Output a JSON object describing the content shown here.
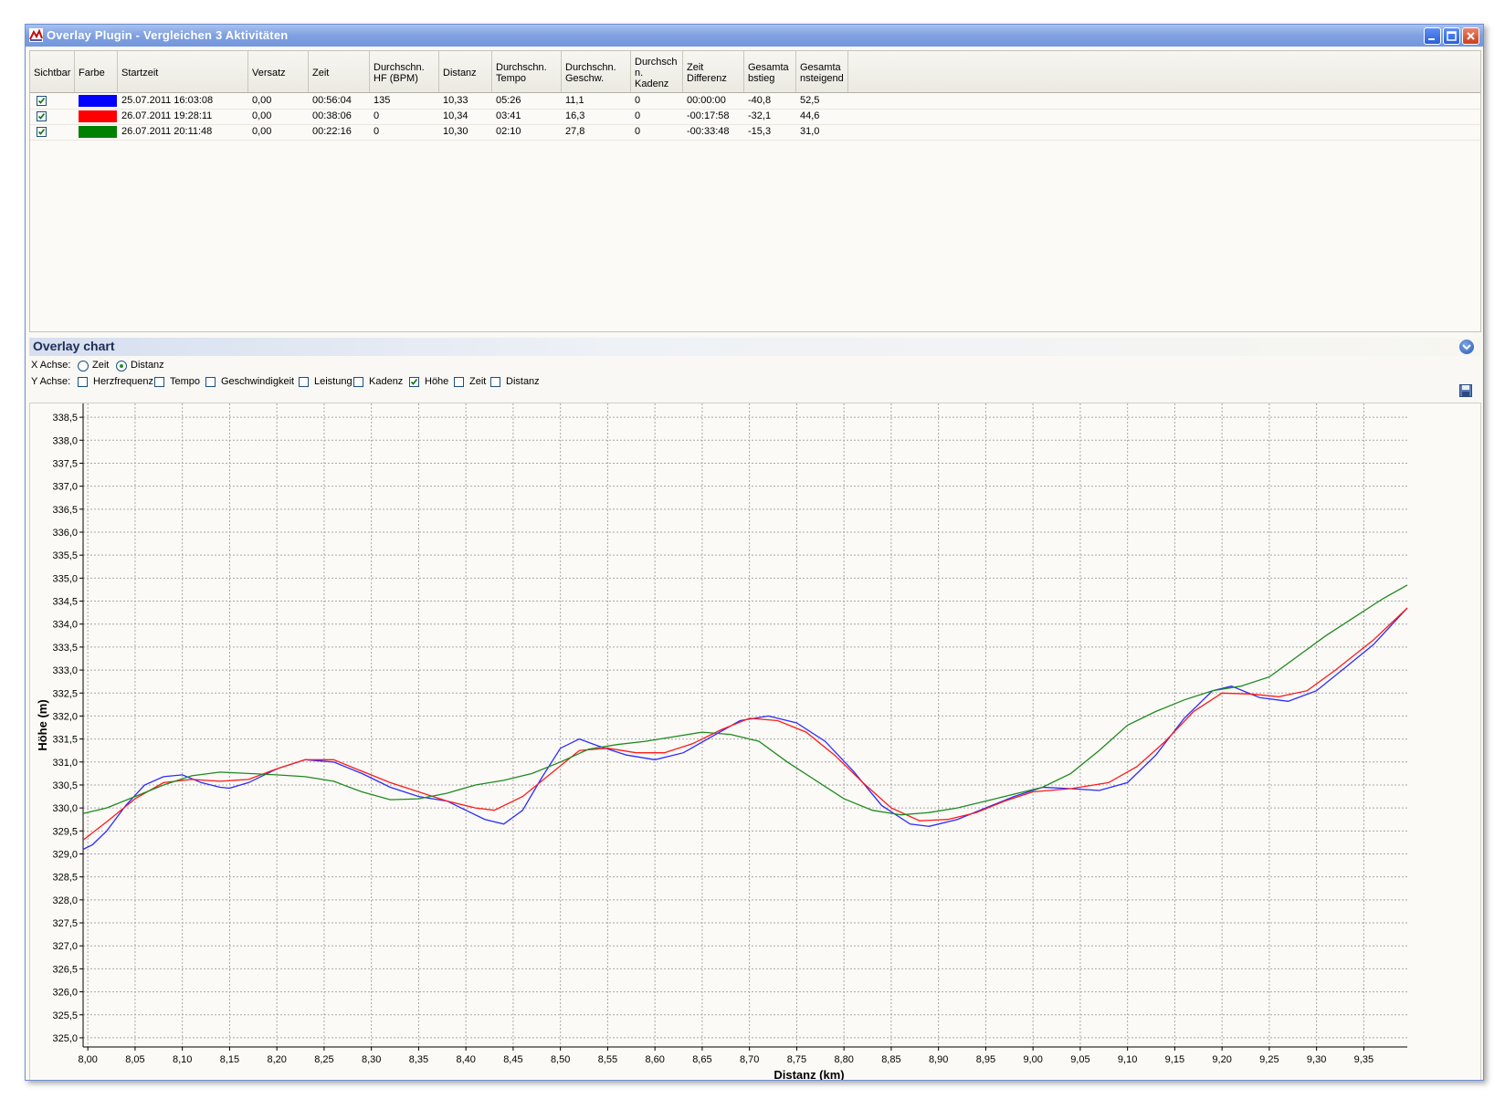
{
  "window": {
    "title": "Overlay Plugin - Vergleichen 3 Aktivitäten",
    "icons": [
      "app-logo-icon",
      "minimize-icon",
      "maximize-icon",
      "close-icon"
    ]
  },
  "table": {
    "headers": [
      "Sichtbar",
      "Farbe",
      "Startzeit",
      "Versatz",
      "Zeit",
      "Durchschn.\nHF (BPM)",
      "Distanz",
      "Durchschn.\nTempo",
      "Durchschn.\nGeschw.",
      "Durchsch\nn.\nKadenz",
      "Zeit\nDifferenz",
      "Gesamta\nbstieg",
      "Gesamta\nnsteigend"
    ],
    "rows": [
      {
        "visible": true,
        "color": "#0000ff",
        "start": "25.07.2011 16:03:08",
        "offset": "0,00",
        "time": "00:56:04",
        "hr": "135",
        "distance": "10,33",
        "pace": "05:26",
        "speed": "11,1",
        "cadence": "0",
        "timediff": "00:00:00",
        "descent": "-40,8",
        "ascent": "52,5"
      },
      {
        "visible": true,
        "color": "#ff0000",
        "start": "26.07.2011 19:28:11",
        "offset": "0,00",
        "time": "00:38:06",
        "hr": "0",
        "distance": "10,34",
        "pace": "03:41",
        "speed": "16,3",
        "cadence": "0",
        "timediff": "-00:17:58",
        "descent": "-32,1",
        "ascent": "44,6"
      },
      {
        "visible": true,
        "color": "#008000",
        "start": "26.07.2011 20:11:48",
        "offset": "0,00",
        "time": "00:22:16",
        "hr": "0",
        "distance": "10,30",
        "pace": "02:10",
        "speed": "27,8",
        "cadence": "0",
        "timediff": "-00:33:48",
        "descent": "-15,3",
        "ascent": "31,0"
      }
    ]
  },
  "chart_panel": {
    "title": "Overlay chart",
    "x_axis_label": "X Achse:",
    "x_options": [
      {
        "label": "Zeit",
        "selected": false
      },
      {
        "label": "Distanz",
        "selected": true
      }
    ],
    "y_axis_label": "Y Achse:",
    "y_options": [
      {
        "label": "Herzfrequenz",
        "checked": false
      },
      {
        "label": "Tempo",
        "checked": false
      },
      {
        "label": "Geschwindigkeit",
        "checked": false
      },
      {
        "label": "Leistung",
        "checked": false
      },
      {
        "label": "Kadenz",
        "checked": false
      },
      {
        "label": "Höhe",
        "checked": true
      },
      {
        "label": "Zeit",
        "checked": false
      },
      {
        "label": "Distanz",
        "checked": false
      }
    ]
  },
  "chart_data": {
    "type": "line",
    "xlabel": "Distanz (km)",
    "ylabel": "Höhe (m)",
    "xlim": [
      7.995,
      9.396
    ],
    "ylim": [
      324.8,
      338.8
    ],
    "x_ticks": [
      "8,00",
      "8,05",
      "8,10",
      "8,15",
      "8,20",
      "8,25",
      "8,30",
      "8,35",
      "8,40",
      "8,45",
      "8,50",
      "8,55",
      "8,60",
      "8,65",
      "8,70",
      "8,75",
      "8,80",
      "8,85",
      "8,90",
      "8,95",
      "9,00",
      "9,05",
      "9,10",
      "9,15",
      "9,20",
      "9,25",
      "9,30",
      "9,35"
    ],
    "y_ticks": [
      "325,0",
      "325,5",
      "326,0",
      "326,5",
      "327,0",
      "327,5",
      "328,0",
      "328,5",
      "329,0",
      "329,5",
      "330,0",
      "330,5",
      "331,0",
      "331,5",
      "332,0",
      "332,5",
      "333,0",
      "333,5",
      "334,0",
      "334,5",
      "335,0",
      "335,5",
      "336,0",
      "336,5",
      "337,0",
      "337,5",
      "338,0",
      "338,5"
    ],
    "grid": true,
    "series": [
      {
        "color": "#2b2bff",
        "points": [
          [
            7.995,
            329.1
          ],
          [
            8.005,
            329.2
          ],
          [
            8.02,
            329.5
          ],
          [
            8.04,
            330.05
          ],
          [
            8.06,
            330.5
          ],
          [
            8.08,
            330.68
          ],
          [
            8.1,
            330.72
          ],
          [
            8.12,
            330.55
          ],
          [
            8.14,
            330.45
          ],
          [
            8.15,
            330.43
          ],
          [
            8.17,
            330.55
          ],
          [
            8.2,
            330.85
          ],
          [
            8.23,
            331.05
          ],
          [
            8.26,
            331.0
          ],
          [
            8.29,
            330.75
          ],
          [
            8.32,
            330.45
          ],
          [
            8.35,
            330.25
          ],
          [
            8.38,
            330.15
          ],
          [
            8.4,
            329.95
          ],
          [
            8.42,
            329.75
          ],
          [
            8.44,
            329.65
          ],
          [
            8.46,
            329.95
          ],
          [
            8.48,
            330.65
          ],
          [
            8.5,
            331.3
          ],
          [
            8.52,
            331.5
          ],
          [
            8.54,
            331.35
          ],
          [
            8.57,
            331.15
          ],
          [
            8.6,
            331.05
          ],
          [
            8.63,
            331.2
          ],
          [
            8.66,
            331.55
          ],
          [
            8.69,
            331.9
          ],
          [
            8.72,
            332.0
          ],
          [
            8.75,
            331.85
          ],
          [
            8.78,
            331.45
          ],
          [
            8.81,
            330.8
          ],
          [
            8.84,
            330.05
          ],
          [
            8.87,
            329.65
          ],
          [
            8.89,
            329.6
          ],
          [
            8.92,
            329.75
          ],
          [
            8.95,
            330.0
          ],
          [
            8.98,
            330.25
          ],
          [
            9.01,
            330.45
          ],
          [
            9.04,
            330.42
          ],
          [
            9.07,
            330.38
          ],
          [
            9.1,
            330.55
          ],
          [
            9.13,
            331.15
          ],
          [
            9.16,
            331.95
          ],
          [
            9.19,
            332.55
          ],
          [
            9.21,
            332.65
          ],
          [
            9.24,
            332.4
          ],
          [
            9.27,
            332.32
          ],
          [
            9.3,
            332.55
          ],
          [
            9.33,
            333.05
          ],
          [
            9.36,
            333.55
          ],
          [
            9.396,
            334.35
          ]
        ]
      },
      {
        "color": "#ff1a1a",
        "points": [
          [
            7.995,
            329.3
          ],
          [
            8.02,
            329.7
          ],
          [
            8.05,
            330.2
          ],
          [
            8.08,
            330.55
          ],
          [
            8.11,
            330.62
          ],
          [
            8.14,
            330.58
          ],
          [
            8.17,
            330.62
          ],
          [
            8.2,
            330.85
          ],
          [
            8.23,
            331.05
          ],
          [
            8.26,
            331.05
          ],
          [
            8.29,
            330.8
          ],
          [
            8.32,
            330.55
          ],
          [
            8.35,
            330.35
          ],
          [
            8.38,
            330.15
          ],
          [
            8.41,
            330.0
          ],
          [
            8.43,
            329.95
          ],
          [
            8.46,
            330.25
          ],
          [
            8.49,
            330.75
          ],
          [
            8.52,
            331.25
          ],
          [
            8.55,
            331.3
          ],
          [
            8.58,
            331.2
          ],
          [
            8.61,
            331.2
          ],
          [
            8.64,
            331.4
          ],
          [
            8.67,
            331.7
          ],
          [
            8.7,
            331.95
          ],
          [
            8.73,
            331.9
          ],
          [
            8.76,
            331.65
          ],
          [
            8.79,
            331.15
          ],
          [
            8.82,
            330.55
          ],
          [
            8.85,
            330.0
          ],
          [
            8.88,
            329.72
          ],
          [
            8.91,
            329.75
          ],
          [
            8.94,
            329.9
          ],
          [
            8.97,
            330.15
          ],
          [
            9.0,
            330.35
          ],
          [
            9.04,
            330.42
          ],
          [
            9.08,
            330.55
          ],
          [
            9.11,
            330.9
          ],
          [
            9.14,
            331.45
          ],
          [
            9.17,
            332.1
          ],
          [
            9.2,
            332.5
          ],
          [
            9.23,
            332.48
          ],
          [
            9.26,
            332.42
          ],
          [
            9.29,
            332.55
          ],
          [
            9.32,
            333.0
          ],
          [
            9.36,
            333.65
          ],
          [
            9.396,
            334.35
          ]
        ]
      },
      {
        "color": "#1f8a1f",
        "points": [
          [
            7.995,
            329.88
          ],
          [
            8.02,
            330.0
          ],
          [
            8.05,
            330.25
          ],
          [
            8.08,
            330.5
          ],
          [
            8.11,
            330.7
          ],
          [
            8.14,
            330.78
          ],
          [
            8.17,
            330.75
          ],
          [
            8.2,
            330.72
          ],
          [
            8.23,
            330.68
          ],
          [
            8.26,
            330.58
          ],
          [
            8.29,
            330.35
          ],
          [
            8.32,
            330.18
          ],
          [
            8.35,
            330.2
          ],
          [
            8.38,
            330.32
          ],
          [
            8.41,
            330.5
          ],
          [
            8.44,
            330.6
          ],
          [
            8.47,
            330.75
          ],
          [
            8.5,
            331.0
          ],
          [
            8.53,
            331.28
          ],
          [
            8.56,
            331.38
          ],
          [
            8.59,
            331.45
          ],
          [
            8.62,
            331.55
          ],
          [
            8.65,
            331.65
          ],
          [
            8.68,
            331.6
          ],
          [
            8.71,
            331.45
          ],
          [
            8.74,
            331.0
          ],
          [
            8.77,
            330.6
          ],
          [
            8.8,
            330.2
          ],
          [
            8.83,
            329.95
          ],
          [
            8.86,
            329.85
          ],
          [
            8.89,
            329.9
          ],
          [
            8.92,
            330.0
          ],
          [
            8.95,
            330.15
          ],
          [
            8.98,
            330.3
          ],
          [
            9.01,
            330.45
          ],
          [
            9.04,
            330.75
          ],
          [
            9.07,
            331.25
          ],
          [
            9.1,
            331.8
          ],
          [
            9.13,
            332.1
          ],
          [
            9.16,
            332.35
          ],
          [
            9.19,
            332.55
          ],
          [
            9.22,
            332.65
          ],
          [
            9.25,
            332.85
          ],
          [
            9.28,
            333.3
          ],
          [
            9.31,
            333.75
          ],
          [
            9.34,
            334.15
          ],
          [
            9.37,
            334.55
          ],
          [
            9.396,
            334.85
          ]
        ]
      }
    ]
  }
}
